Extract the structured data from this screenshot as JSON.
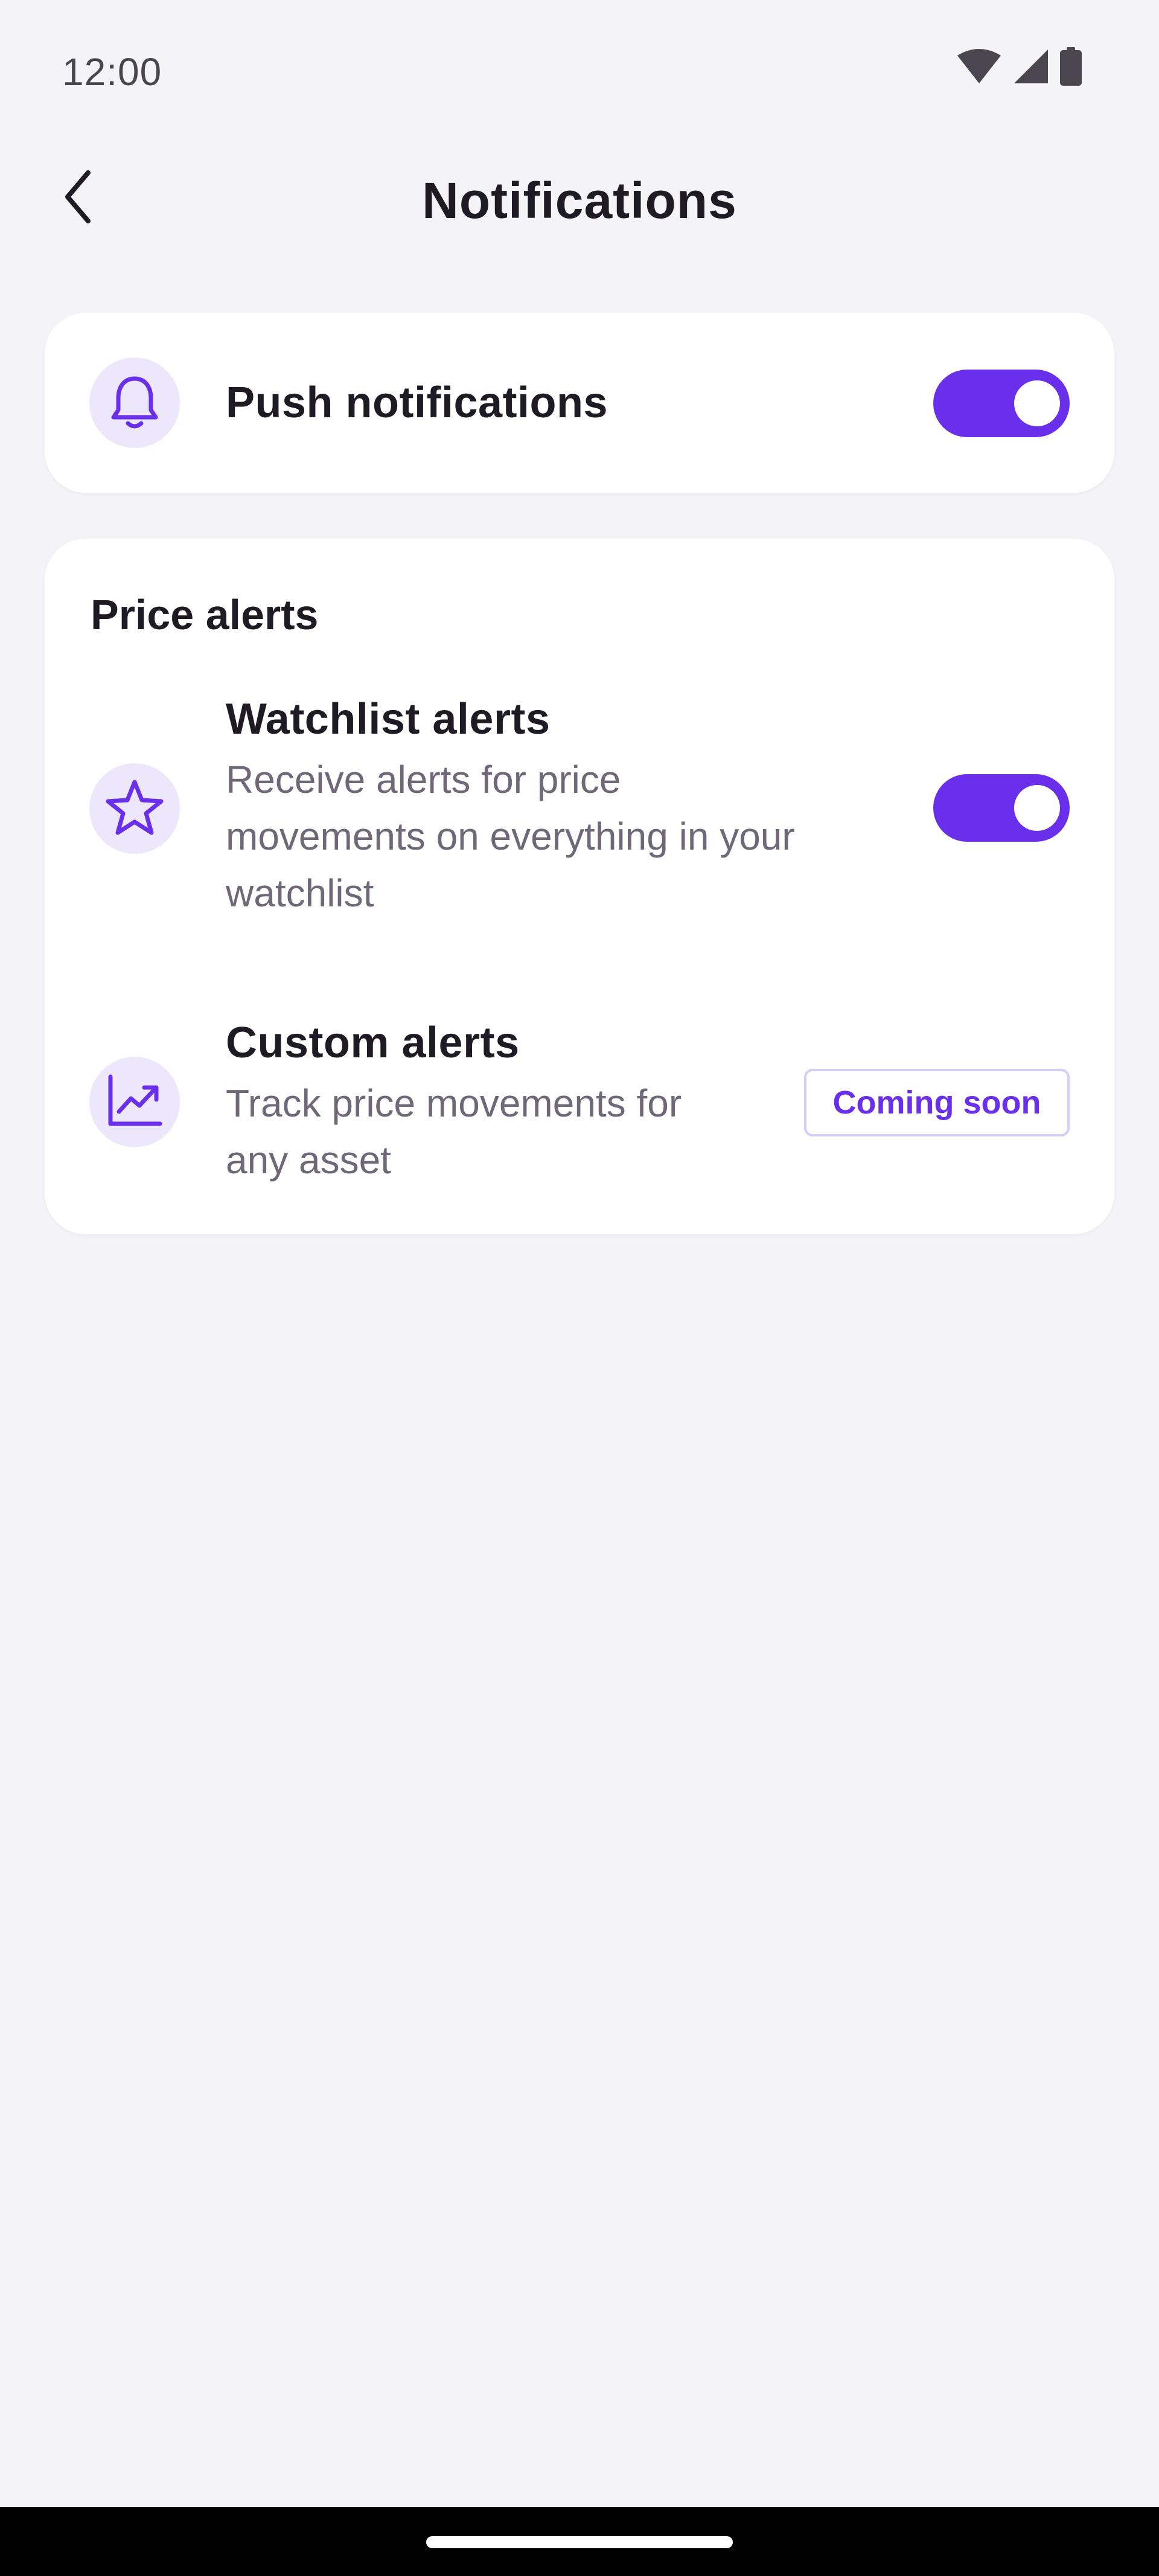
{
  "status_bar": {
    "time": "12:00",
    "icons": [
      "wifi-icon",
      "cellular-signal-icon",
      "battery-icon"
    ]
  },
  "header": {
    "back_icon": "chevron-left-icon",
    "title": "Notifications"
  },
  "push_card": {
    "icon": "bell-icon",
    "label": "Push notifications",
    "toggle_on": true
  },
  "price_alerts": {
    "section_title": "Price alerts",
    "items": [
      {
        "icon": "star-icon",
        "title": "Watchlist alerts",
        "description_lines": [
          "Receive alerts for price",
          "movements on everything in your",
          "watchlist"
        ],
        "toggle_on": true
      },
      {
        "icon": "trending-up-chart-icon",
        "title": "Custom alerts",
        "description_lines": [
          "Track price movements for",
          "any asset"
        ],
        "badge": "Coming soon"
      }
    ]
  },
  "colors": {
    "accent": "#6A2FEA",
    "icon_bg": "#EDE7FB",
    "background": "#F4F3F8",
    "card": "#FFFFFF",
    "text_primary": "#1F1B24",
    "text_secondary": "#6F6878",
    "badge_border": "#D8CDF8"
  }
}
